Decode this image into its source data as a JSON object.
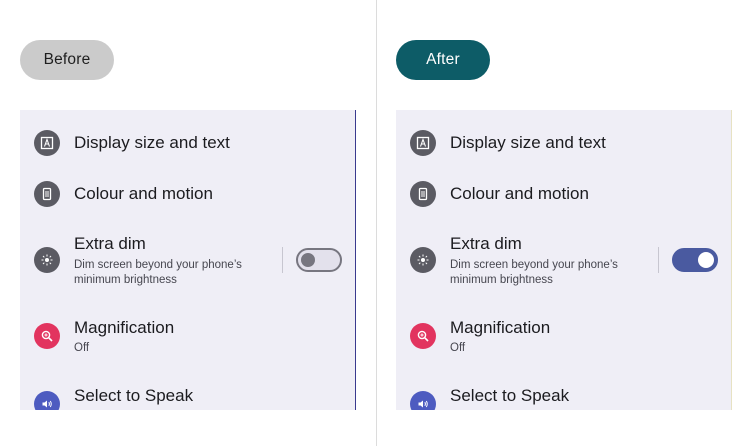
{
  "labels": {
    "before": "Before",
    "after": "After"
  },
  "settings": {
    "display_size": {
      "title": "Display size and text"
    },
    "colour_motion": {
      "title": "Colour and motion"
    },
    "extra_dim": {
      "title": "Extra dim",
      "subtitle_line1": "Dim screen beyond your phone’s",
      "subtitle_line2": "minimum brightness"
    },
    "magnification": {
      "title": "Magnification",
      "status": "Off"
    },
    "select_to_speak": {
      "title": "Select to Speak"
    }
  },
  "states": {
    "before_extra_dim_on": false,
    "after_extra_dim_on": true
  },
  "colors": {
    "after_pill": "#0d5c67",
    "before_pill": "#cbcbcb",
    "toggle_on": "#4a5aa0",
    "icon_dark": "#5b5b63",
    "icon_magnification": "#e2345f",
    "icon_speak": "#4d5bc0"
  },
  "icons": {
    "display_size": "text-size-icon",
    "colour_motion": "palette-icon",
    "extra_dim": "brightness-icon",
    "magnification": "zoom-icon",
    "select_to_speak": "speaker-icon"
  }
}
